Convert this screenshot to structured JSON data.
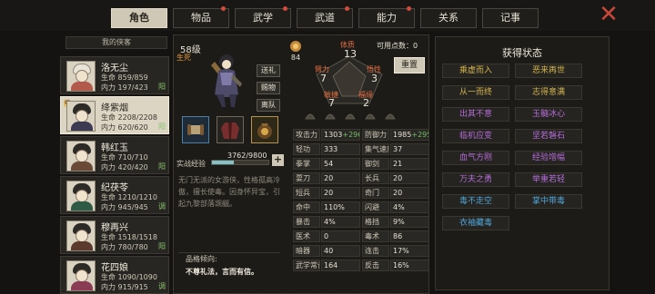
{
  "tabs": [
    {
      "label": "角色",
      "active": true,
      "dot": false
    },
    {
      "label": "物品",
      "active": false,
      "dot": true
    },
    {
      "label": "武学",
      "active": false,
      "dot": true
    },
    {
      "label": "武道",
      "active": false,
      "dot": true
    },
    {
      "label": "能力",
      "active": false,
      "dot": true
    },
    {
      "label": "关系",
      "active": false,
      "dot": false
    },
    {
      "label": "记事",
      "active": false,
      "dot": false
    }
  ],
  "close_label": "✕",
  "roster": {
    "title": "我的侠客",
    "members": [
      {
        "name": "洛无尘",
        "hp": "生命 859/859",
        "mp": "内力 197/423",
        "tag": "阳",
        "active": false
      },
      {
        "name": "绛紫烟",
        "hp": "生命 2208/2208",
        "mp": "内力 620/620",
        "tag": "阳",
        "active": true,
        "marker": "统"
      },
      {
        "name": "韩红玉",
        "hp": "生命 710/710",
        "mp": "内力 420/420",
        "tag": "阳",
        "active": false
      },
      {
        "name": "纪茯苓",
        "hp": "生命 1210/1210",
        "mp": "内力 945/945",
        "tag": "调",
        "active": false
      },
      {
        "name": "穆再兴",
        "hp": "生命 1518/1518",
        "mp": "内力 780/780",
        "tag": "阳",
        "active": false
      },
      {
        "name": "花四娘",
        "hp": "生命 1090/1090",
        "mp": "内力 915/915",
        "tag": "调",
        "active": false
      }
    ]
  },
  "hero": {
    "level": "58级",
    "state": "生死",
    "buttons": [
      "送礼",
      "赐物",
      "离队"
    ],
    "exp_label": "实战经验",
    "exp_value": "3762/9800",
    "exp_fraction": 0.384,
    "exp_plus": "+",
    "description": "无门无派的女游侠，性格孤高冷傲，擅长使毒。因身怀异宝，引起九黎部落觊觎。",
    "trait_heading": "品格倾向:",
    "trait_value": "不尊礼法，言而有信。"
  },
  "attributes": {
    "potential_value": "84",
    "free_points": "可用点数：0",
    "reset_label": "重置",
    "body": {
      "label": "体质",
      "value": "13"
    },
    "arm": {
      "label": "臂力",
      "value": "7"
    },
    "nature": {
      "label": "悟性",
      "value": "3"
    },
    "agility": {
      "label": "敏捷",
      "value": "7"
    },
    "luck": {
      "label": "福缘",
      "value": "2"
    }
  },
  "stats": [
    [
      {
        "label": "攻击力",
        "value": "1303",
        "plus": "+296"
      },
      {
        "label": "防御力",
        "value": "1985",
        "plus": "+295"
      }
    ],
    [
      {
        "label": "轻功",
        "value": "333"
      },
      {
        "label": "集气速度",
        "value": "37"
      }
    ],
    [
      {
        "label": "拳掌",
        "value": "54"
      },
      {
        "label": "御剑",
        "value": "21"
      }
    ],
    [
      {
        "label": "耍刀",
        "value": "20"
      },
      {
        "label": "长兵",
        "value": "20"
      }
    ],
    [
      {
        "label": "短兵",
        "value": "20"
      },
      {
        "label": "奇门",
        "value": "20"
      }
    ],
    [
      {
        "label": "命中",
        "value": "110%"
      },
      {
        "label": "闪避",
        "value": "4%"
      }
    ],
    [
      {
        "label": "暴击",
        "value": "4%"
      },
      {
        "label": "格挡",
        "value": "9%"
      }
    ],
    [
      {
        "label": "医术",
        "value": "0"
      },
      {
        "label": "毒术",
        "value": "86"
      }
    ],
    [
      {
        "label": "暗器",
        "value": "40"
      },
      {
        "label": "连击",
        "value": "17%"
      }
    ],
    [
      {
        "label": "武学常识",
        "value": "164"
      },
      {
        "label": "反击",
        "value": "16%"
      }
    ]
  ],
  "gained": {
    "title": "获得状态",
    "items": [
      {
        "label": "乘虚而入",
        "color": "#d4b450"
      },
      {
        "label": "恶来再世",
        "color": "#d4b450"
      },
      {
        "label": "从一而终",
        "color": "#d4b450"
      },
      {
        "label": "志得意满",
        "color": "#d4b450"
      },
      {
        "label": "出其不意",
        "color": "#b56cd9"
      },
      {
        "label": "玉髓冰心",
        "color": "#b56cd9"
      },
      {
        "label": "临机应变",
        "color": "#b56cd9"
      },
      {
        "label": "坚若磐石",
        "color": "#b56cd9"
      },
      {
        "label": "血气方刚",
        "color": "#b56cd9"
      },
      {
        "label": "经验增幅",
        "color": "#b56cd9"
      },
      {
        "label": "万夫之勇",
        "color": "#b56cd9"
      },
      {
        "label": "举重若轻",
        "color": "#b56cd9"
      },
      {
        "label": "毒不走空",
        "color": "#4fa6d9"
      },
      {
        "label": "掌中带毒",
        "color": "#4fa6d9"
      },
      {
        "label": "衣袖藏毒",
        "color": "#4fa6d9"
      }
    ]
  }
}
